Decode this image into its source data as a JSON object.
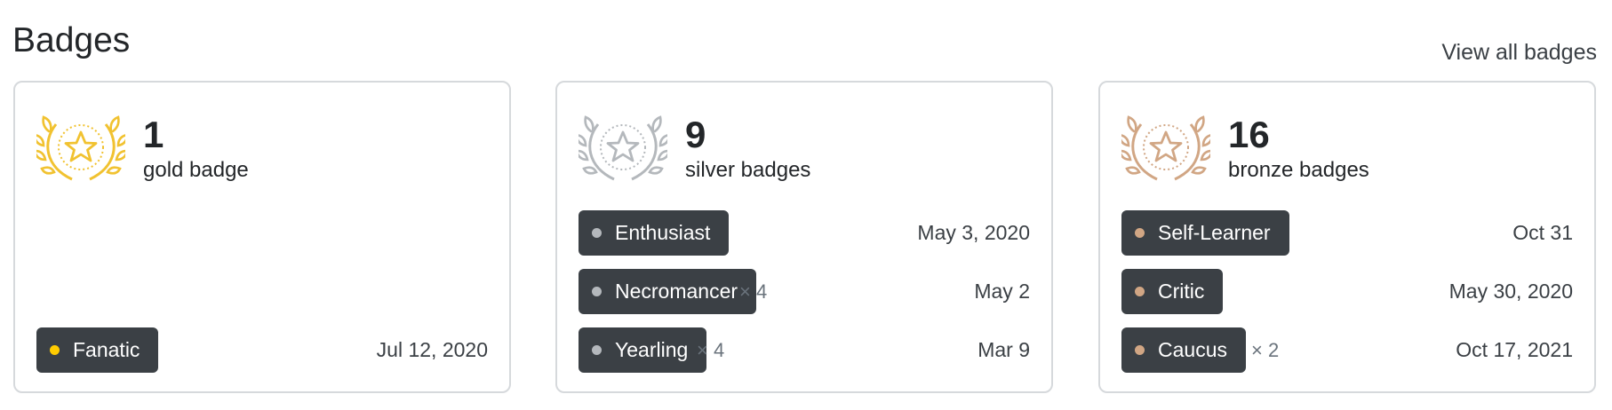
{
  "header": {
    "title": "Badges",
    "view_all_label": "View all badges"
  },
  "cards": [
    {
      "tier": "gold",
      "count": "1",
      "label": "gold badge",
      "award_icon": "gold-award-wreath-icon",
      "color": "#f1c230",
      "dot_color": "#ffcc01",
      "badges": [
        {
          "name": "Fanatic",
          "multiplier": "",
          "date": "Jul 12, 2020"
        }
      ]
    },
    {
      "tier": "silver",
      "count": "9",
      "label": "silver badges",
      "award_icon": "silver-award-wreath-icon",
      "color": "#b4b8bc",
      "dot_color": "#b4b8bc",
      "badges": [
        {
          "name": "Enthusiast",
          "multiplier": "",
          "date": "May 3, 2020"
        },
        {
          "name": "Necromancer",
          "multiplier": "× 4",
          "date": "May 2"
        },
        {
          "name": "Yearling",
          "multiplier": "× 4",
          "date": "Mar 9"
        }
      ]
    },
    {
      "tier": "bronze",
      "count": "16",
      "label": "bronze badges",
      "award_icon": "bronze-award-wreath-icon",
      "color": "#d1a684",
      "dot_color": "#d1a684",
      "badges": [
        {
          "name": "Self-Learner",
          "multiplier": "",
          "date": "Oct 31"
        },
        {
          "name": "Critic",
          "multiplier": "",
          "date": "May 30, 2020"
        },
        {
          "name": "Caucus",
          "multiplier": "× 2",
          "date": "Oct 17, 2021"
        }
      ]
    }
  ]
}
